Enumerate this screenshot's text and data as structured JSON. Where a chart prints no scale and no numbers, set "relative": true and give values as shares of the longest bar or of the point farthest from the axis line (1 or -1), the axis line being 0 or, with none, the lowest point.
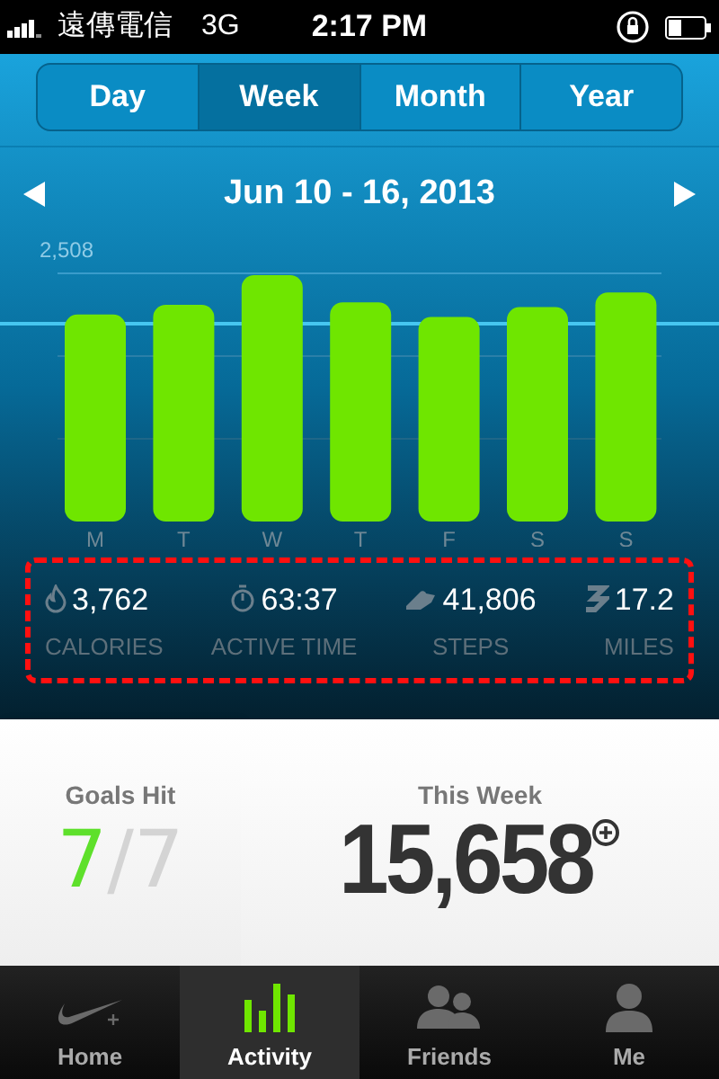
{
  "status_bar": {
    "carrier": "遠傳電信",
    "network": "3G",
    "time": "2:17 PM"
  },
  "tabs": [
    {
      "label": "Day",
      "selected": false
    },
    {
      "label": "Week",
      "selected": true
    },
    {
      "label": "Month",
      "selected": false
    },
    {
      "label": "Year",
      "selected": false
    }
  ],
  "date_range": "Jun 10 - 16, 2013",
  "chart_data": {
    "type": "bar",
    "relative": true,
    "categories": [
      "M",
      "T",
      "W",
      "T",
      "F",
      "S",
      "S"
    ],
    "series": [
      {
        "color": "#6fe600",
        "values": [
          0.84,
          0.88,
          1,
          0.89,
          0.83,
          0.87,
          0.93
        ]
      }
    ],
    "annotations": [
      {
        "text": "2,508"
      }
    ]
  },
  "stats": {
    "highlighted": true,
    "items": [
      {
        "kind": "calories",
        "value": "3,762",
        "label": "CALORIES"
      },
      {
        "kind": "time",
        "value": "63:37",
        "label": "ACTIVE TIME"
      },
      {
        "kind": "steps",
        "value": "41,806",
        "label": "STEPS"
      },
      {
        "kind": "miles",
        "value": "17.2",
        "label": "MILES"
      }
    ]
  },
  "goals": {
    "title": "Goals Hit",
    "hit": "7",
    "separator": "/",
    "total": "7"
  },
  "this_week": {
    "title": "This Week",
    "value": "15,658"
  },
  "nav": [
    {
      "label": "Home",
      "kind": "home",
      "selected": false
    },
    {
      "label": "Activity",
      "kind": "activity",
      "selected": true
    },
    {
      "label": "Friends",
      "kind": "friends",
      "selected": false
    },
    {
      "label": "Me",
      "kind": "me",
      "selected": false
    }
  ]
}
